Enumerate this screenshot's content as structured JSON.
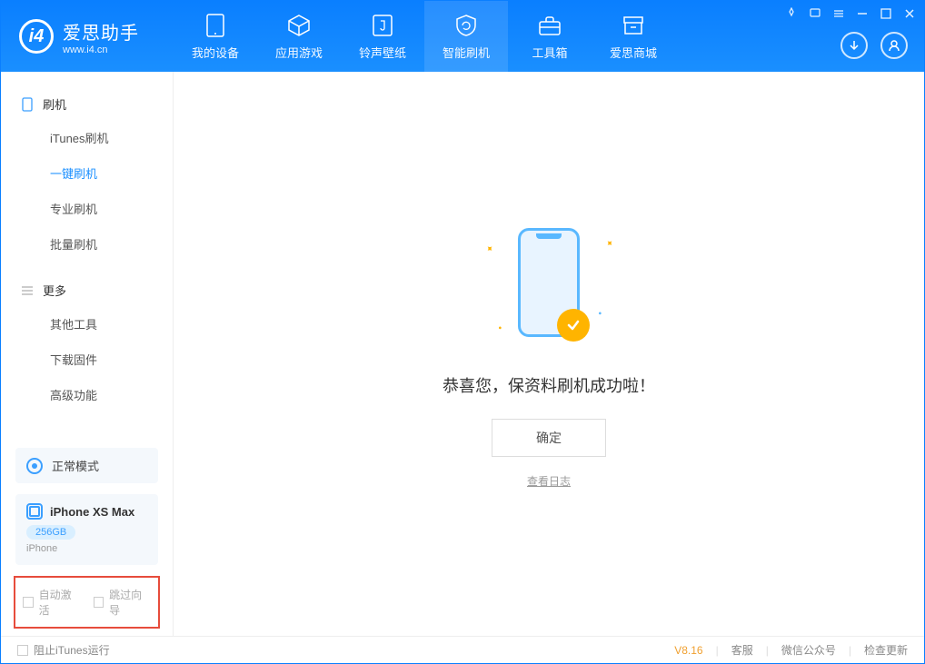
{
  "app": {
    "name": "爱思助手",
    "url": "www.i4.cn"
  },
  "tabs": [
    {
      "label": "我的设备",
      "icon": "device"
    },
    {
      "label": "应用游戏",
      "icon": "cube"
    },
    {
      "label": "铃声壁纸",
      "icon": "music"
    },
    {
      "label": "智能刷机",
      "icon": "refresh",
      "active": true
    },
    {
      "label": "工具箱",
      "icon": "toolbox"
    },
    {
      "label": "爱思商城",
      "icon": "store"
    }
  ],
  "sidebar": {
    "section1": {
      "title": "刷机",
      "items": [
        "iTunes刷机",
        "一键刷机",
        "专业刷机",
        "批量刷机"
      ],
      "activeIndex": 1
    },
    "section2": {
      "title": "更多",
      "items": [
        "其他工具",
        "下载固件",
        "高级功能"
      ]
    }
  },
  "mode": {
    "label": "正常模式"
  },
  "device": {
    "name": "iPhone XS Max",
    "storage": "256GB",
    "type": "iPhone"
  },
  "bottomChecks": {
    "autoActivate": "自动激活",
    "skipGuide": "跳过向导"
  },
  "main": {
    "successText": "恭喜您，保资料刷机成功啦！",
    "confirmLabel": "确定",
    "logLink": "查看日志"
  },
  "statusbar": {
    "blockItunes": "阻止iTunes运行",
    "version": "V8.16",
    "links": [
      "客服",
      "微信公众号",
      "检查更新"
    ]
  }
}
